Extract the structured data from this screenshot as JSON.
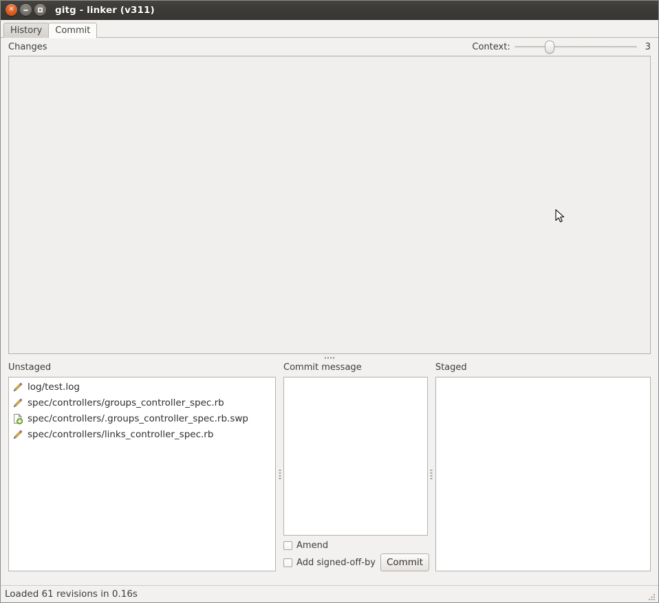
{
  "window": {
    "title": "gitg - linker (v311)",
    "buttons": [
      {
        "name": "close",
        "label": "×"
      },
      {
        "name": "minimize",
        "label": ""
      },
      {
        "name": "maximize",
        "label": ""
      }
    ]
  },
  "tabs": [
    {
      "label": "History",
      "active": false
    },
    {
      "label": "Commit",
      "active": true
    }
  ],
  "changes": {
    "label": "Changes",
    "context_label": "Context:",
    "context_value": "3",
    "slider_min": 0,
    "slider_max": 10
  },
  "panes": {
    "unstaged": {
      "title": "Unstaged",
      "files": [
        {
          "icon": "pencil-icon",
          "path": "log/test.log"
        },
        {
          "icon": "pencil-icon",
          "path": "spec/controllers/groups_controller_spec.rb"
        },
        {
          "icon": "new-file-icon",
          "path": "spec/controllers/.groups_controller_spec.rb.swp"
        },
        {
          "icon": "pencil-icon",
          "path": "spec/controllers/links_controller_spec.rb"
        }
      ]
    },
    "commit_message": {
      "title": "Commit message",
      "value": "",
      "placeholder": ""
    },
    "staged": {
      "title": "Staged",
      "files": []
    }
  },
  "commit_controls": {
    "amend_label": "Amend",
    "amend_checked": false,
    "signed_off_label": "Add signed-off-by",
    "signed_off_checked": false,
    "commit_button_label": "Commit"
  },
  "statusbar": {
    "text": "Loaded 61 revisions in 0.16s"
  },
  "colors": {
    "titlebar": "#3c3a36",
    "close_button": "#df5f22",
    "window_bg": "#f2f1f0",
    "border": "#b4b1ac",
    "text": "#3c3c3c"
  }
}
